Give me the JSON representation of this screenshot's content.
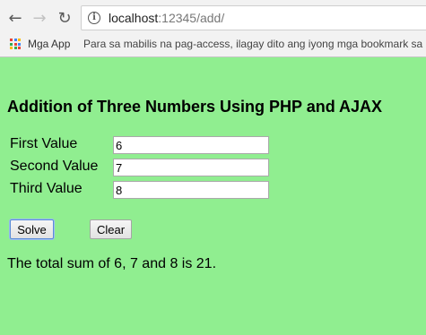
{
  "browser": {
    "url_host": "localhost",
    "url_rest": ":12345/add/",
    "bookmarks_apps_label": "Mga App",
    "bookmarks_hint": "Para sa mabilis na pag-access, ilagay dito ang iyong mga bookmark sa b"
  },
  "page": {
    "title": "Addition of Three Numbers Using PHP and AJAX",
    "fields": [
      {
        "label": "First Value",
        "value": "6"
      },
      {
        "label": "Second Value",
        "value": "7"
      },
      {
        "label": "Third Value",
        "value": "8"
      }
    ],
    "solve_label": "Solve",
    "clear_label": "Clear",
    "result_text": "The total sum of 6, 7 and 8 is 21."
  }
}
